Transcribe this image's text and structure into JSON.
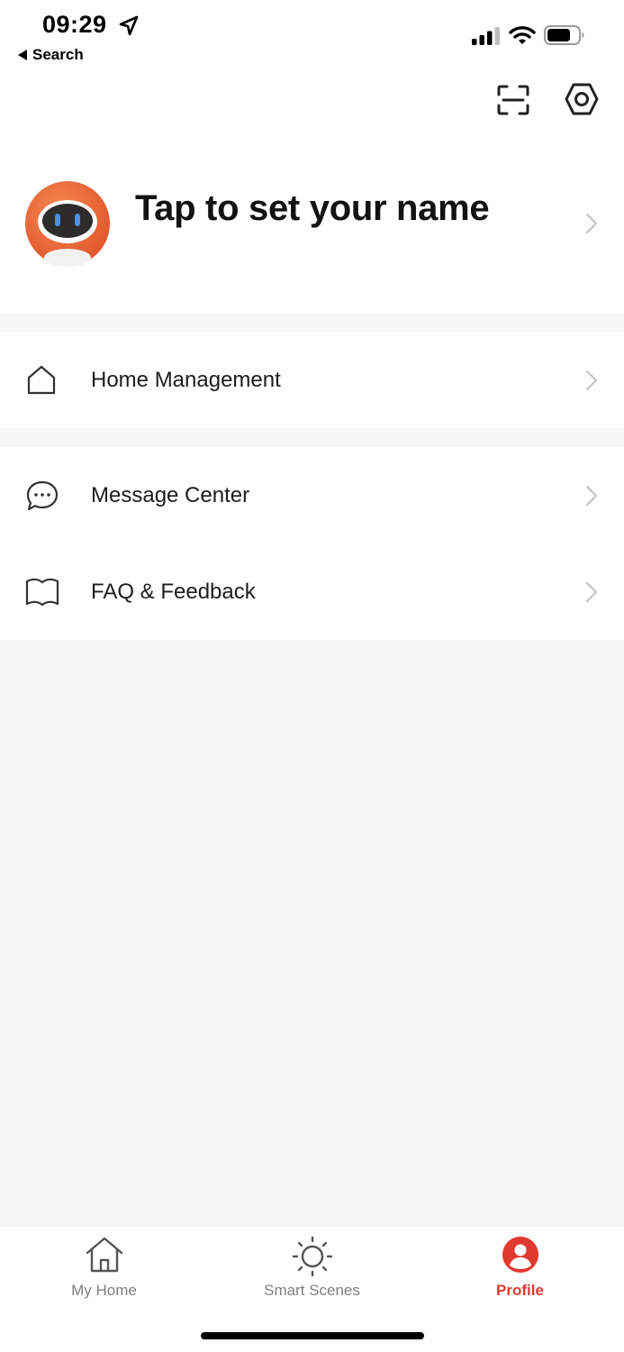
{
  "status_bar": {
    "time": "09:29",
    "back_label": "Search"
  },
  "header": {
    "scan_icon": "scan-icon",
    "settings_icon": "settings-icon"
  },
  "profile": {
    "name_prompt": "Tap to set your name",
    "avatar_icon": "robot-avatar"
  },
  "menu": {
    "items": [
      {
        "label": "Home Management",
        "icon": "home-icon"
      },
      {
        "label": "Message Center",
        "icon": "message-icon"
      },
      {
        "label": "FAQ & Feedback",
        "icon": "book-icon"
      }
    ]
  },
  "tabbar": {
    "tabs": [
      {
        "label": "My Home",
        "icon": "home-icon",
        "active": false
      },
      {
        "label": "Smart Scenes",
        "icon": "sun-icon",
        "active": false
      },
      {
        "label": "Profile",
        "icon": "profile-icon",
        "active": true
      }
    ]
  },
  "colors": {
    "accent": "#e0392f",
    "background": "#f7f7f7",
    "card": "#fefefe",
    "inactive_tab": "#808080"
  }
}
